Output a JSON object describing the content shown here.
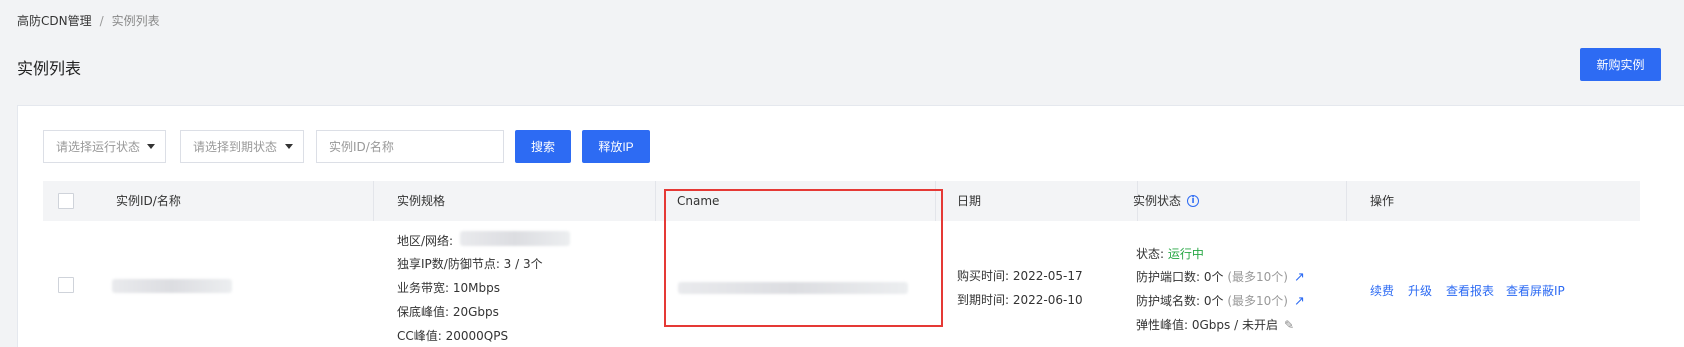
{
  "breadcrumb": {
    "root": "高防CDN管理",
    "separator": "/",
    "current": "实例列表"
  },
  "page": {
    "title": "实例列表",
    "new_button": "新购实例"
  },
  "filters": {
    "run_status_placeholder": "请选择运行状态",
    "expire_status_placeholder": "请选择到期状态",
    "search_placeholder": "实例ID/名称",
    "search_button": "搜索",
    "release_ip_button": "释放IP"
  },
  "table": {
    "columns": [
      "实例ID/名称",
      "实例规格",
      "Cname",
      "日期",
      "实例状态",
      "操作"
    ],
    "rows": [
      {
        "spec": {
          "region_label": "地区/网络:",
          "ip_nodes": "独享IP数/防御节点: 3 / 3个",
          "bandwidth": "业务带宽: 10Mbps",
          "guarantee_peak": "保底峰值: 20Gbps",
          "cc_peak": "CC峰值: 20000QPS"
        },
        "date": {
          "purchase": "购买时间: 2022-05-17",
          "expire": "到期时间: 2022-06-10"
        },
        "status": {
          "state_label": "状态:",
          "state_value": "运行中",
          "port_label": "防护端口数:",
          "port_value": "0个",
          "port_max": "(最多10个)",
          "domain_label": "防护域名数:",
          "domain_value": "0个",
          "domain_max": "(最多10个)",
          "elastic": "弹性峰值: 0Gbps / 未开启"
        },
        "actions": [
          "续费",
          "升级",
          "查看报表",
          "查看屏蔽IP"
        ]
      }
    ]
  },
  "colors": {
    "primary": "#2d6bf3",
    "running": "#28a745",
    "highlight": "#e53935"
  },
  "icons": {
    "info": "info-icon",
    "arrow": "share-arrow-icon",
    "edit": "edit-pencil-icon",
    "caret": "caret-down-icon"
  }
}
